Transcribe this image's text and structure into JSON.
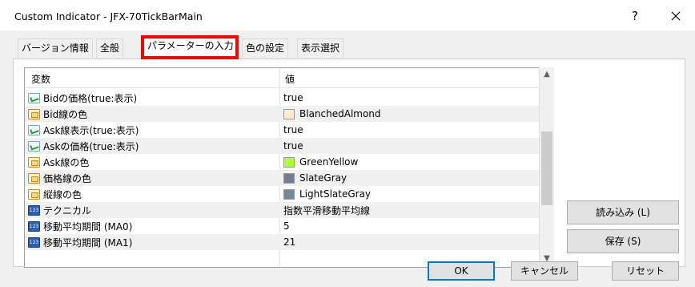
{
  "window": {
    "title": "Custom Indicator - JFX-70TickBarMain",
    "help_label": "?"
  },
  "tabs": [
    {
      "label": "バージョン情報"
    },
    {
      "label": "全般"
    },
    {
      "label": "パラメーターの入力"
    },
    {
      "label": "色の設定"
    },
    {
      "label": "表示選択"
    }
  ],
  "grid": {
    "headers": {
      "name": "変数",
      "value": "値"
    },
    "rows": [
      {
        "type": "bool",
        "name": "Bidの価格(true:表示)",
        "value": "true"
      },
      {
        "type": "color",
        "name": "Bid線の色",
        "value": "BlanchedAlmond",
        "swatch": "#ffebcd"
      },
      {
        "type": "bool",
        "name": "Ask線表示(true:表示)",
        "value": "true"
      },
      {
        "type": "bool",
        "name": "Askの価格(true:表示)",
        "value": "true"
      },
      {
        "type": "color",
        "name": "Ask線の色",
        "value": "GreenYellow",
        "swatch": "#adff2f"
      },
      {
        "type": "color",
        "name": "価格線の色",
        "value": "SlateGray",
        "swatch": "#708090"
      },
      {
        "type": "color",
        "name": "縦線の色",
        "value": "LightSlateGray",
        "swatch": "#778899"
      },
      {
        "type": "num",
        "name": "テクニカル",
        "value": "指数平滑移動平均線"
      },
      {
        "type": "num",
        "name": "移動平均期間 (MA0)",
        "value": "5"
      },
      {
        "type": "num",
        "name": "移動平均期間 (MA1)",
        "value": "21"
      }
    ]
  },
  "side_buttons": {
    "load": "読み込み (L)",
    "save": "保存 (S)"
  },
  "footer": {
    "ok": "OK",
    "cancel": "キャンセル",
    "reset": "リセット"
  },
  "icons": {
    "bool_row": "boolean-param-icon",
    "color_row": "color-param-icon",
    "num_row": "numeric-param-icon",
    "num_text": "123"
  },
  "colors": {
    "highlight_border": "#ff0000",
    "default_button_border": "#0078d7"
  }
}
